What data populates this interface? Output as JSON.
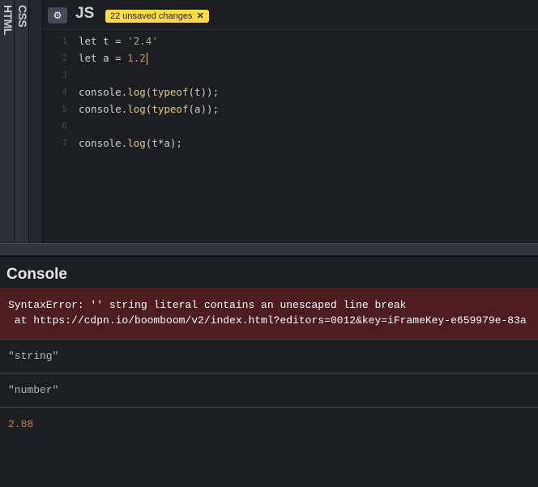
{
  "side_tabs": {
    "html_label": "HTML",
    "css_label": "CSS"
  },
  "js_editor": {
    "settings_icon": "gear-icon",
    "title": "JS",
    "unsaved_badge": "22 unsaved changes",
    "close_glyph": "✕",
    "lines": [
      {
        "num": "1",
        "parts": [
          {
            "t": "let t = ",
            "c": "plain"
          },
          {
            "t": "'2.4'",
            "c": "str"
          }
        ]
      },
      {
        "num": "2",
        "parts": [
          {
            "t": "let a = ",
            "c": "plain"
          },
          {
            "t": "1.2",
            "c": "num"
          }
        ],
        "cursor": true
      },
      {
        "num": "3",
        "parts": []
      },
      {
        "num": "4",
        "parts": [
          {
            "t": "console.",
            "c": "plain"
          },
          {
            "t": "log",
            "c": "kw"
          },
          {
            "t": "(",
            "c": "plain"
          },
          {
            "t": "typeof",
            "c": "kw"
          },
          {
            "t": "(t));",
            "c": "plain"
          }
        ]
      },
      {
        "num": "5",
        "parts": [
          {
            "t": "console.",
            "c": "plain"
          },
          {
            "t": "log",
            "c": "kw"
          },
          {
            "t": "(",
            "c": "plain"
          },
          {
            "t": "typeof",
            "c": "kw"
          },
          {
            "t": "(a));",
            "c": "plain"
          }
        ]
      },
      {
        "num": "6",
        "parts": []
      },
      {
        "num": "7",
        "parts": [
          {
            "t": "console.",
            "c": "plain"
          },
          {
            "t": "log",
            "c": "kw"
          },
          {
            "t": "(t*a);",
            "c": "plain"
          }
        ]
      }
    ]
  },
  "console": {
    "title": "Console",
    "error_line1": "SyntaxError: '' string literal contains an unescaped line break",
    "error_line2": " at https://cdpn.io/boomboom/v2/index.html?editors=0012&key=iFrameKey-e659979e-83a",
    "log1": "\"string\"",
    "log2": "\"number\"",
    "log3": "2.88"
  },
  "colors": {
    "keyword": "#ddca7e",
    "string": "#96b38a",
    "number": "#d88568",
    "error_bg": "#4d1c1f",
    "badge_bg": "#ffdd40"
  }
}
